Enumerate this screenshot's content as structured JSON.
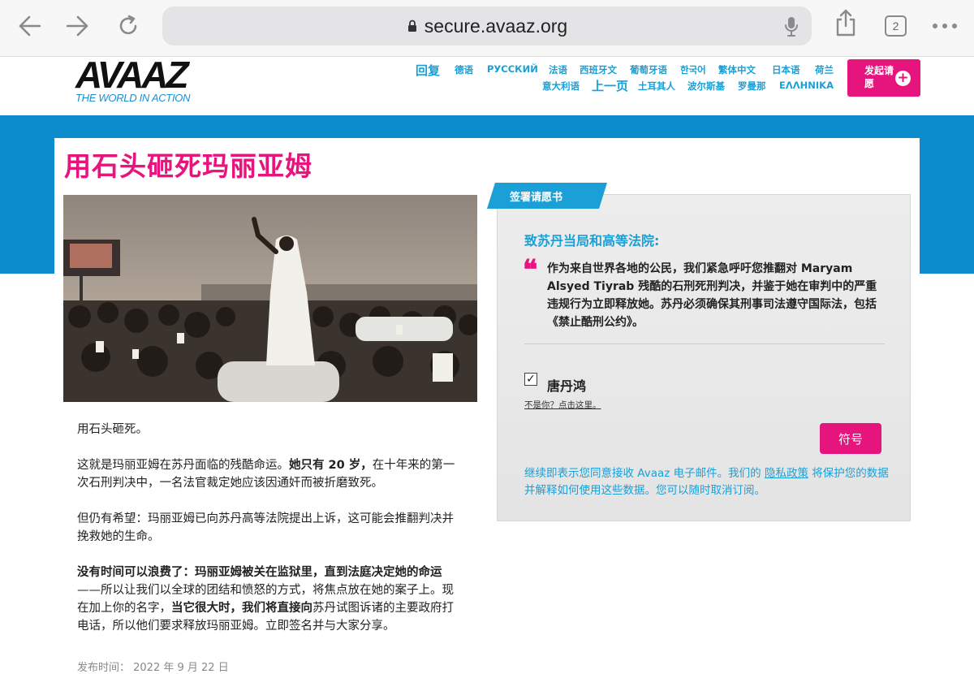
{
  "browser": {
    "url": "secure.avaaz.org",
    "tab_count": "2"
  },
  "header": {
    "logo_text": "AVAAZ",
    "logo_tagline": "THE WORLD IN ACTION",
    "languages": [
      "回复",
      "德语",
      "РУССКИЙ",
      "法语",
      "西班牙文",
      "葡萄牙语",
      "한국어",
      "繁体中文",
      "日本语",
      "荷兰",
      "意大利语",
      "上一页",
      "土耳其人",
      "波尔斯基",
      "罗曼那",
      "ΕΛΛΗΝΙΚΑ"
    ],
    "start_petition": "发起请愿"
  },
  "page": {
    "title": "用石头砸死玛丽亚姆"
  },
  "article": {
    "p1": "用石头砸死。",
    "p2_a": "这就是玛丽亚姆在苏丹面临的残酷命运。",
    "p2_b": "她只有 20 岁，",
    "p2_c": "在十年来的第一次石刑判决中，一名法官裁定她应该因通奸而被折磨致死。",
    "p3": "但仍有希望：玛丽亚姆已向苏丹高等法院提出上诉，这可能会推翻判决并挽救她的生命。",
    "p4_a": "没有时间可以浪费了：玛丽亚姆被关在监狱里，直到法庭决定她的命运",
    "p4_b": "——所以让我们以全球的团结和愤怒的方式，将焦点放在她的案子上。现在加上你的名字，",
    "p4_c": "当它很大时，我们将直接向",
    "p4_d": "苏丹试图诉诸的主要政府打电话，所以他们要求释放玛丽亚姆。立即签名并与大家分享。",
    "published": "发布时间： 2022 年 9 月 22 日"
  },
  "petition": {
    "tag": "签署请愿书",
    "heading": "致苏丹当局和高等法院:",
    "quote_mark": "❝",
    "text": "作为来自世界各地的公民，我们紧急呼吁您推翻对 Maryam Alsyed Tiyrab 残酷的石刑死刑判决，并鉴于她在审判中的严重违规行为立即释放她。苏丹必须确保其刑事司法遵守国际法，包括《禁止酷刑公约》。",
    "checkbox_mark": "✓",
    "user_name": "唐丹鸿",
    "not_you": "不是你？点击这里。",
    "sign_button": "符号",
    "disclaimer_a": "继续即表示您同意接收 Avaaz 电子邮件。我们的 ",
    "privacy_link": "隐私政策",
    "disclaimer_b": " 将保护您的数据并解释如何使用这些数据。您可以随时取消订阅。"
  },
  "colors": {
    "brand_pink": "#e6157d",
    "brand_blue": "#0d8ccd",
    "link_blue": "#1aa0d6"
  }
}
